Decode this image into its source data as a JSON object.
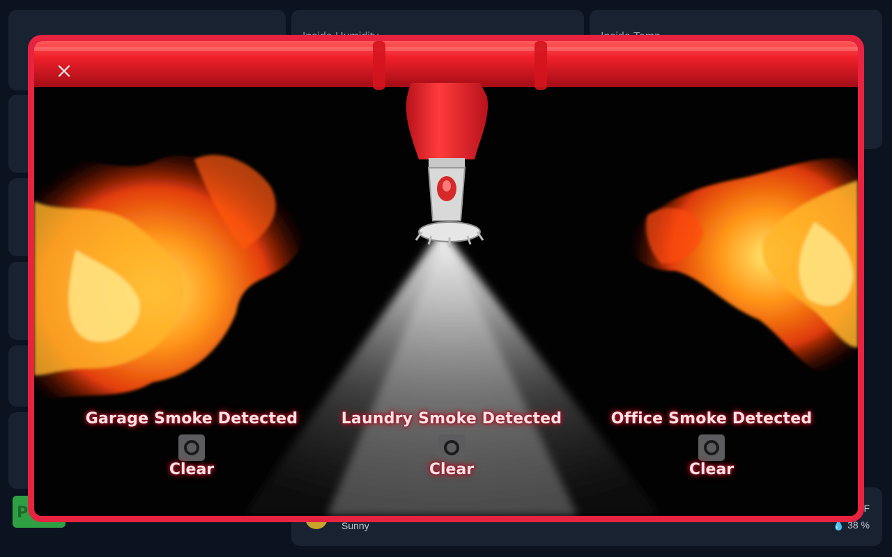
{
  "dashboard": {
    "cards": [
      {
        "label": ""
      },
      {
        "label": "Inside Humidity"
      },
      {
        "label": "Inside Temp"
      }
    ],
    "weather": {
      "condition": "Sunny",
      "humidity": "38 %",
      "temp_partial": "F"
    },
    "left_button_partial": "P"
  },
  "modal": {
    "close_icon": "close-icon",
    "sensors": [
      {
        "title": "Garage Smoke Detected",
        "state": "Clear",
        "icon": "smoke-detector-icon"
      },
      {
        "title": "Laundry Smoke Detected",
        "state": "Clear",
        "icon": "smoke-detector-icon"
      },
      {
        "title": "Office Smoke Detected",
        "state": "Clear",
        "icon": "smoke-detector-icon"
      }
    ]
  },
  "colors": {
    "modal_border": "#e8233f",
    "pipe_red": "#e6202c",
    "text_glow": "#c21a30"
  }
}
